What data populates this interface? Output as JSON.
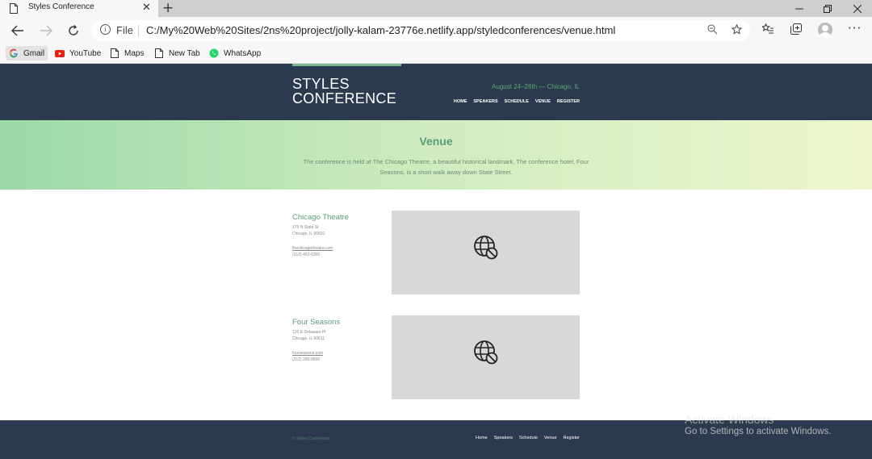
{
  "browser": {
    "tab_title": "Styles Conference",
    "tab_close": "✕",
    "new_tab": "+",
    "omnibox_scheme": "File",
    "url": "C:/My%20Web%20Sites/2ns%20project/jolly-kalam-23776e.netlify.app/styledconferences/venue.html",
    "bookmarks": [
      {
        "label": "Gmail",
        "icon": "google-icon"
      },
      {
        "label": "YouTube",
        "icon": "youtube-icon"
      },
      {
        "label": "Maps",
        "icon": "page-icon"
      },
      {
        "label": "New Tab",
        "icon": "page-icon"
      },
      {
        "label": "WhatsApp",
        "icon": "whatsapp-icon"
      }
    ]
  },
  "site": {
    "logo_line1": "STYLES",
    "logo_line2": "CONFERENCE",
    "tagline": "August 24–26th — Chicago, IL",
    "nav": [
      "HOME",
      "SPEAKERS",
      "SCHEDULE",
      "VENUE",
      "REGISTER"
    ],
    "hero_title": "Venue",
    "hero_text": "The conference is held at The Chicago Theatre, a beautiful historical landmark. The conference hotel, Four Seasons, is a short walk away down State Street.",
    "venues": [
      {
        "name": "Chicago Theatre",
        "street": "175 N State St",
        "city": "Chicago, IL 60601",
        "website": "thechicagotheatre.com",
        "phone": "(312) 462-6300"
      },
      {
        "name": "Four Seasons",
        "street": "120 E Delaware Pl",
        "city": "Chicago, IL 60611",
        "website": "fourseasons.com",
        "phone": "(312) 280-8800"
      }
    ],
    "copyright": "© Styles Conference",
    "footer_nav": [
      "Home",
      "Speakers",
      "Schedule",
      "Venue",
      "Register"
    ]
  },
  "os_watermark": {
    "line1": "Activate Windows",
    "line2": "Go to Settings to activate Windows."
  },
  "colors": {
    "header_bg": "#2c3a50",
    "accent_green": "#5b9b7a",
    "hero_gradient_start": "#9bd9a8",
    "hero_gradient_end": "#eef6cf"
  }
}
